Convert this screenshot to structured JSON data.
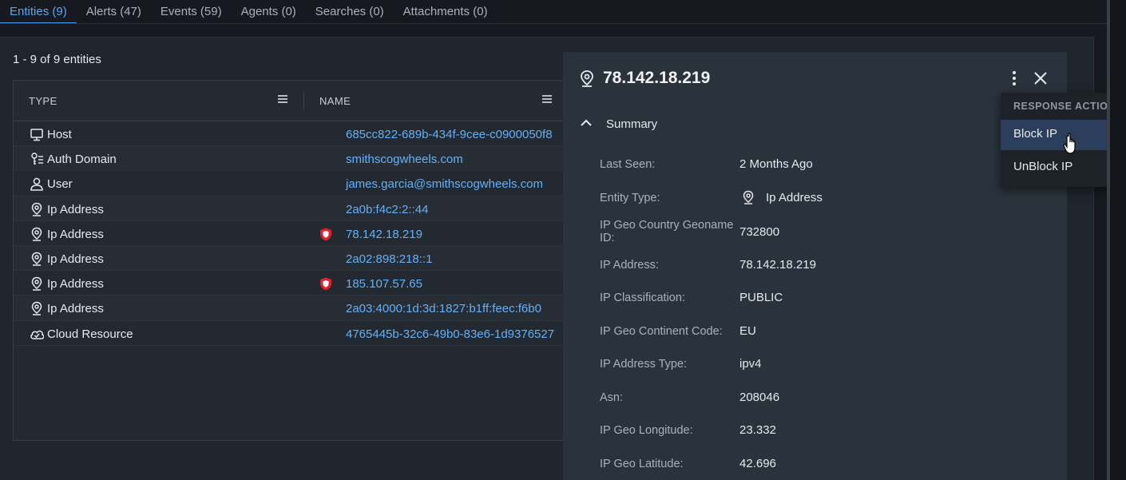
{
  "tabs": [
    {
      "label": "Entities (9)",
      "active": true
    },
    {
      "label": "Alerts (47)"
    },
    {
      "label": "Events (59)"
    },
    {
      "label": "Agents (0)"
    },
    {
      "label": "Searches (0)"
    },
    {
      "label": "Attachments (0)"
    }
  ],
  "entities_count": "1 - 9 of 9 entities",
  "table": {
    "col_type": "TYPE",
    "col_name": "NAME",
    "rows": [
      {
        "type": "Host",
        "icon": "monitor-icon",
        "name": "685cc822-689b-434f-9cee-c0900050f8",
        "flagged": false
      },
      {
        "type": "Auth Domain",
        "icon": "auth-domain-icon",
        "name": "smithscogwheels.com",
        "flagged": false
      },
      {
        "type": "User",
        "icon": "user-icon",
        "name": "james.garcia@smithscogwheels.com",
        "flagged": false
      },
      {
        "type": "Ip Address",
        "icon": "location-pin-icon",
        "name": "2a0b:f4c2:2::44",
        "flagged": false
      },
      {
        "type": "Ip Address",
        "icon": "location-pin-icon",
        "name": "78.142.18.219",
        "flagged": true
      },
      {
        "type": "Ip Address",
        "icon": "location-pin-icon",
        "name": "2a02:898:218::1",
        "flagged": false
      },
      {
        "type": "Ip Address",
        "icon": "location-pin-icon",
        "name": "185.107.57.65",
        "flagged": true
      },
      {
        "type": "Ip Address",
        "icon": "location-pin-icon",
        "name": "2a03:4000:1d:3d:1827:b1ff:feec:f6b0",
        "flagged": false
      },
      {
        "type": "Cloud Resource",
        "icon": "cloud-check-icon",
        "name": "4765445b-32c6-49b0-83e6-1d9376527",
        "flagged": false
      }
    ]
  },
  "detail": {
    "title": "78.142.18.219",
    "section": "Summary",
    "fields": [
      {
        "label": "Last Seen:",
        "value": "2 Months Ago"
      },
      {
        "label": "Entity Type:",
        "value": "Ip Address",
        "icon": "location-pin-icon"
      },
      {
        "label": "IP Geo Country Geoname ID:",
        "value": "732800"
      },
      {
        "label": "IP Address:",
        "value": "78.142.18.219"
      },
      {
        "label": "IP Classification:",
        "value": "PUBLIC"
      },
      {
        "label": "IP Geo Continent Code:",
        "value": "EU"
      },
      {
        "label": "IP Address Type:",
        "value": "ipv4"
      },
      {
        "label": "Asn:",
        "value": "208046"
      },
      {
        "label": "IP Geo Longitude:",
        "value": "23.332"
      },
      {
        "label": "IP Geo Latitude:",
        "value": "42.696"
      }
    ]
  },
  "dropdown": {
    "header": "RESPONSE ACTIONS",
    "items": [
      {
        "label": "Block IP",
        "hover": true
      },
      {
        "label": "UnBlock IP"
      }
    ]
  },
  "colors": {
    "accent": "#4a97e6",
    "link": "#67b0f5",
    "flag": "#e0202f"
  }
}
